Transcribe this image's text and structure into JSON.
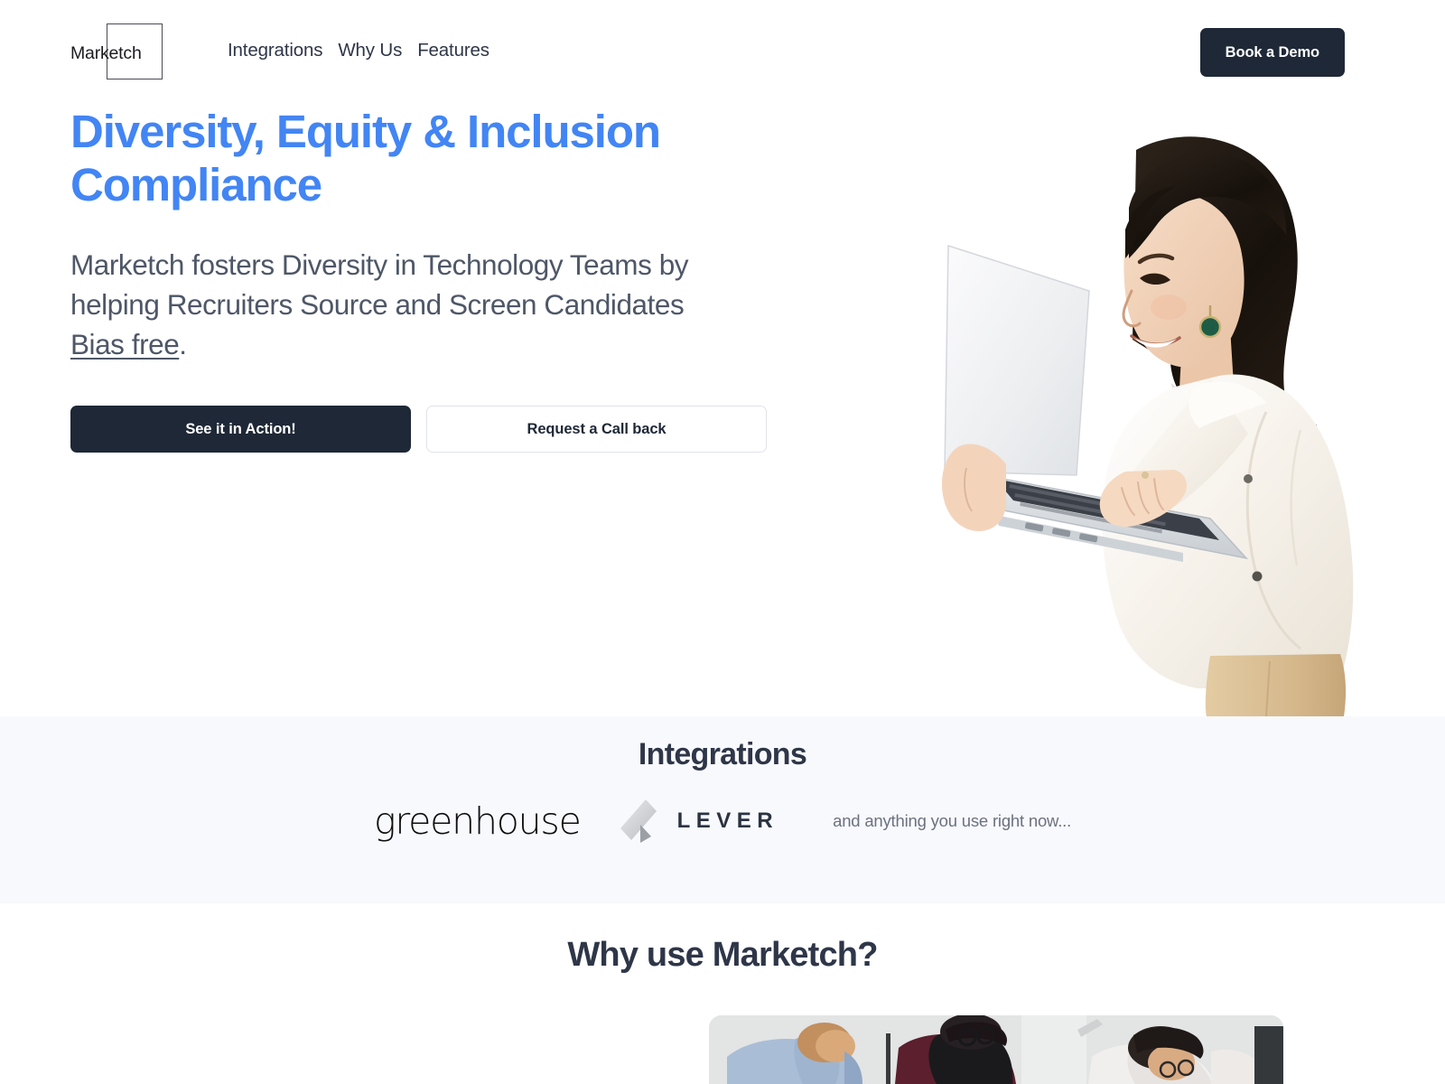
{
  "brand": {
    "name": "Marketch",
    "logo_shape": "square-outline"
  },
  "header": {
    "nav": [
      {
        "label": "Integrations"
      },
      {
        "label": "Why Us"
      },
      {
        "label": "Features"
      }
    ],
    "cta_label": "Book a Demo"
  },
  "hero": {
    "title": "Diversity, Equity & Inclusion Compliance",
    "sub_before": "Marketch fosters Diversity in Technology Teams by helping Recruiters Source and Screen Candidates ",
    "sub_underlined": "Bias free",
    "sub_after": ".",
    "primary_cta": "See it in Action!",
    "secondary_cta": "Request a Call back",
    "image_alt": "woman-with-laptop-photo"
  },
  "integrations": {
    "title": "Integrations",
    "partners": [
      {
        "name": "greenhouse",
        "wordmark": "greenhouse"
      },
      {
        "name": "lever",
        "wordmark": "LEVER"
      }
    ],
    "note": "and anything you use right now..."
  },
  "why": {
    "title": "Why use Marketch?",
    "image_alt": "team-collaborating-photo"
  },
  "colors": {
    "accent_blue": "#4285f4",
    "dark_navy": "#1e2836",
    "body_gray": "#4e5767",
    "heading_slate": "#2e3648",
    "section_bg": "#f8f9fc",
    "border_gray": "#dfe3e9"
  }
}
